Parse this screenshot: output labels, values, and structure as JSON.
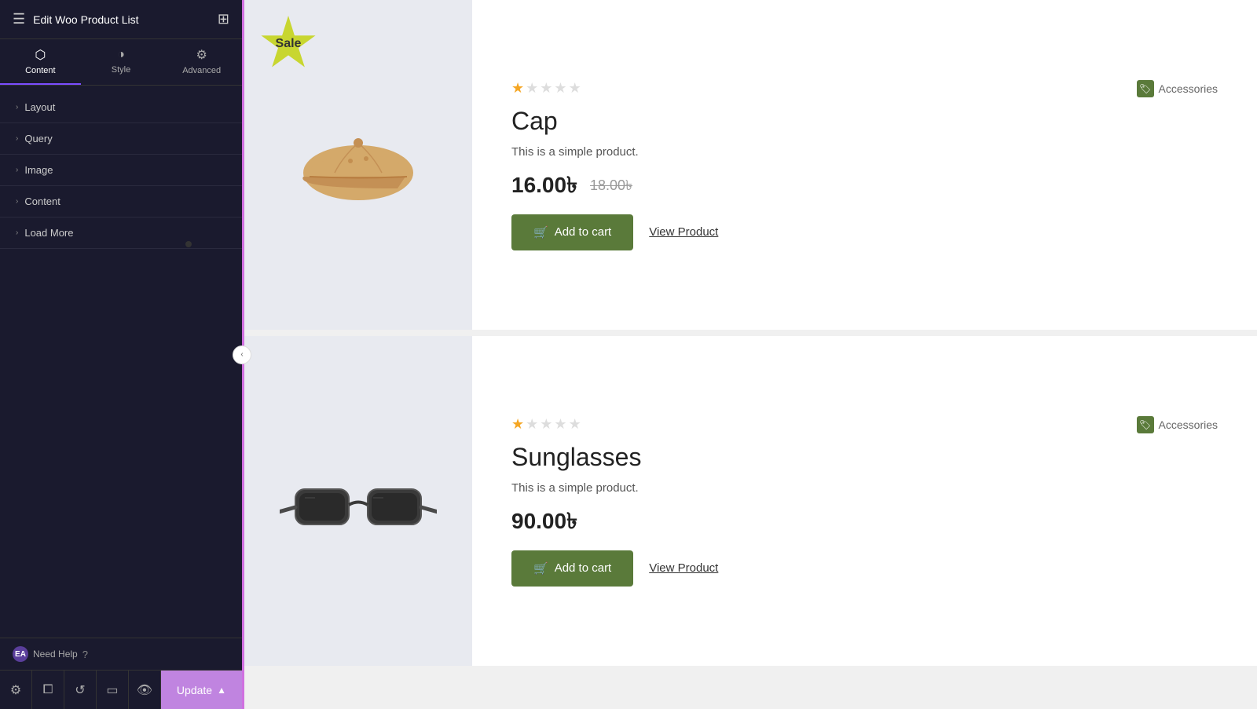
{
  "sidebar": {
    "title": "Edit Woo Product List",
    "tabs": [
      {
        "id": "content",
        "label": "Content",
        "icon": "⬡",
        "active": true
      },
      {
        "id": "style",
        "label": "Style",
        "icon": "◑"
      },
      {
        "id": "advanced",
        "label": "Advanced",
        "icon": "⚙"
      }
    ],
    "menu_items": [
      {
        "id": "layout",
        "label": "Layout"
      },
      {
        "id": "query",
        "label": "Query"
      },
      {
        "id": "image",
        "label": "Image"
      },
      {
        "id": "content",
        "label": "Content"
      },
      {
        "id": "load-more",
        "label": "Load More"
      }
    ],
    "need_help_label": "Need Help",
    "footer": {
      "update_label": "Update"
    }
  },
  "products": [
    {
      "id": "cap",
      "name": "Cap",
      "description": "This is a simple product.",
      "price_current": "16.00৳",
      "price_original": "18.00৳",
      "has_sale": true,
      "sale_label": "Sale",
      "category": "Accessories",
      "stars_filled": 1,
      "stars_empty": 4,
      "add_to_cart_label": "Add to cart",
      "view_product_label": "View Product"
    },
    {
      "id": "sunglasses",
      "name": "Sunglasses",
      "description": "This is a simple product.",
      "price_current": "90.00৳",
      "price_original": "",
      "has_sale": false,
      "sale_label": "",
      "category": "Accessories",
      "stars_filled": 1,
      "stars_empty": 4,
      "add_to_cart_label": "Add to cart",
      "view_product_label": "View Product"
    }
  ],
  "colors": {
    "active_tab_border": "#7c4dff",
    "add_to_cart_bg": "#5a7a3a",
    "update_btn_bg": "#c084e0",
    "sale_badge_bg": "#c8d630",
    "sidebar_bg": "#1a1a2e",
    "border_accent": "#d070e0"
  }
}
